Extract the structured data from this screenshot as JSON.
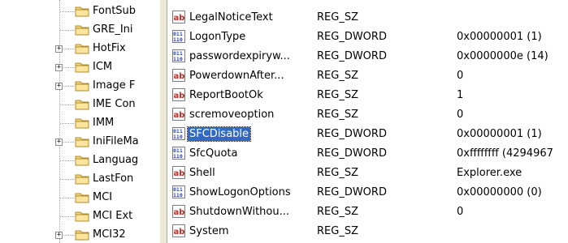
{
  "tree": {
    "items": [
      {
        "label": "FontSub",
        "expander": ""
      },
      {
        "label": "GRE_Ini",
        "expander": ""
      },
      {
        "label": "HotFix",
        "expander": "+"
      },
      {
        "label": "ICM",
        "expander": "+"
      },
      {
        "label": "Image F",
        "expander": "+"
      },
      {
        "label": "IME Con",
        "expander": ""
      },
      {
        "label": "IMM",
        "expander": ""
      },
      {
        "label": "IniFileMa",
        "expander": "+"
      },
      {
        "label": "Languag",
        "expander": ""
      },
      {
        "label": "LastFon",
        "expander": ""
      },
      {
        "label": "MCI",
        "expander": ""
      },
      {
        "label": "MCI Ext",
        "expander": ""
      },
      {
        "label": "MCI32",
        "expander": "+"
      }
    ]
  },
  "values": {
    "rows": [
      {
        "name": "LegalNoticeText",
        "type": "REG_SZ",
        "data": "",
        "icon": "string-value-icon"
      },
      {
        "name": "LogonType",
        "type": "REG_DWORD",
        "data": "0x00000001 (1)",
        "icon": "dword-value-icon"
      },
      {
        "name": "passwordexpiryw...",
        "type": "REG_DWORD",
        "data": "0x0000000e (14)",
        "icon": "dword-value-icon"
      },
      {
        "name": "PowerdownAfter...",
        "type": "REG_SZ",
        "data": "0",
        "icon": "string-value-icon"
      },
      {
        "name": "ReportBootOk",
        "type": "REG_SZ",
        "data": "1",
        "icon": "string-value-icon"
      },
      {
        "name": "scremoveoption",
        "type": "REG_SZ",
        "data": "0",
        "icon": "string-value-icon"
      },
      {
        "name": "SFCDisable",
        "type": "REG_DWORD",
        "data": "0x00000001 (1)",
        "icon": "dword-value-icon",
        "selected": true
      },
      {
        "name": "SfcQuota",
        "type": "REG_DWORD",
        "data": "0xffffffff (4294967",
        "icon": "dword-value-icon"
      },
      {
        "name": "Shell",
        "type": "REG_SZ",
        "data": "Explorer.exe",
        "icon": "string-value-icon"
      },
      {
        "name": "ShowLogonOptions",
        "type": "REG_DWORD",
        "data": "0x00000000 (0)",
        "icon": "dword-value-icon"
      },
      {
        "name": "ShutdownWithou...",
        "type": "REG_SZ",
        "data": "0",
        "icon": "string-value-icon"
      },
      {
        "name": "System",
        "type": "REG_SZ",
        "data": "",
        "icon": "string-value-icon"
      }
    ]
  },
  "colors": {
    "selection": "#316ac5",
    "folder": "#f5d67a",
    "string_icon_red": "#c8281e",
    "dword_icon_blue": "#2846b4"
  }
}
